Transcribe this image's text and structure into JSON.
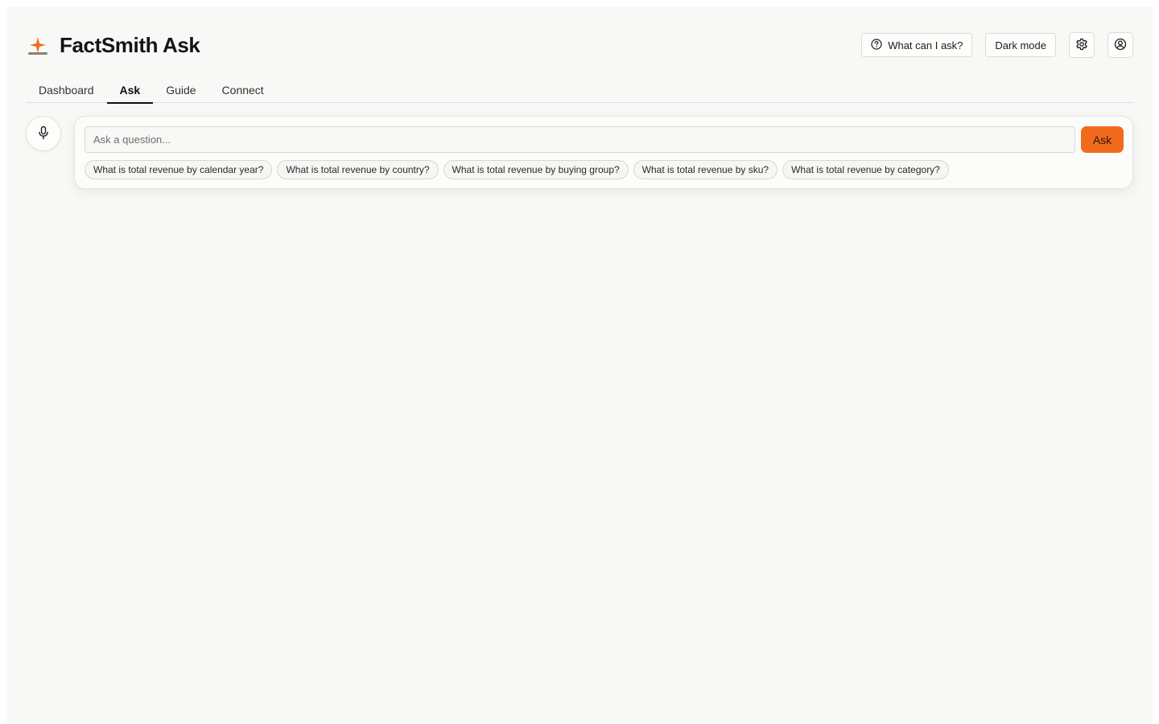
{
  "app": {
    "title": "FactSmith Ask",
    "accent_color": "#f26b1d",
    "logo_icon": "sparkle-icon"
  },
  "header": {
    "help_label": "What can I ask?",
    "help_icon": "help-circle-icon",
    "dark_mode_label": "Dark mode",
    "settings_icon": "gear-icon",
    "account_icon": "user-circle-icon"
  },
  "tabs": [
    {
      "label": "Dashboard",
      "active": false
    },
    {
      "label": "Ask",
      "active": true
    },
    {
      "label": "Guide",
      "active": false
    },
    {
      "label": "Connect",
      "active": false
    }
  ],
  "ask": {
    "mic_icon": "microphone-icon",
    "placeholder": "Ask a question...",
    "value": "",
    "submit_label": "Ask",
    "suggestions": [
      "What is total revenue by calendar year?",
      "What is total revenue by country?",
      "What is total revenue by buying group?",
      "What is total revenue by sku?",
      "What is total revenue by category?"
    ]
  }
}
